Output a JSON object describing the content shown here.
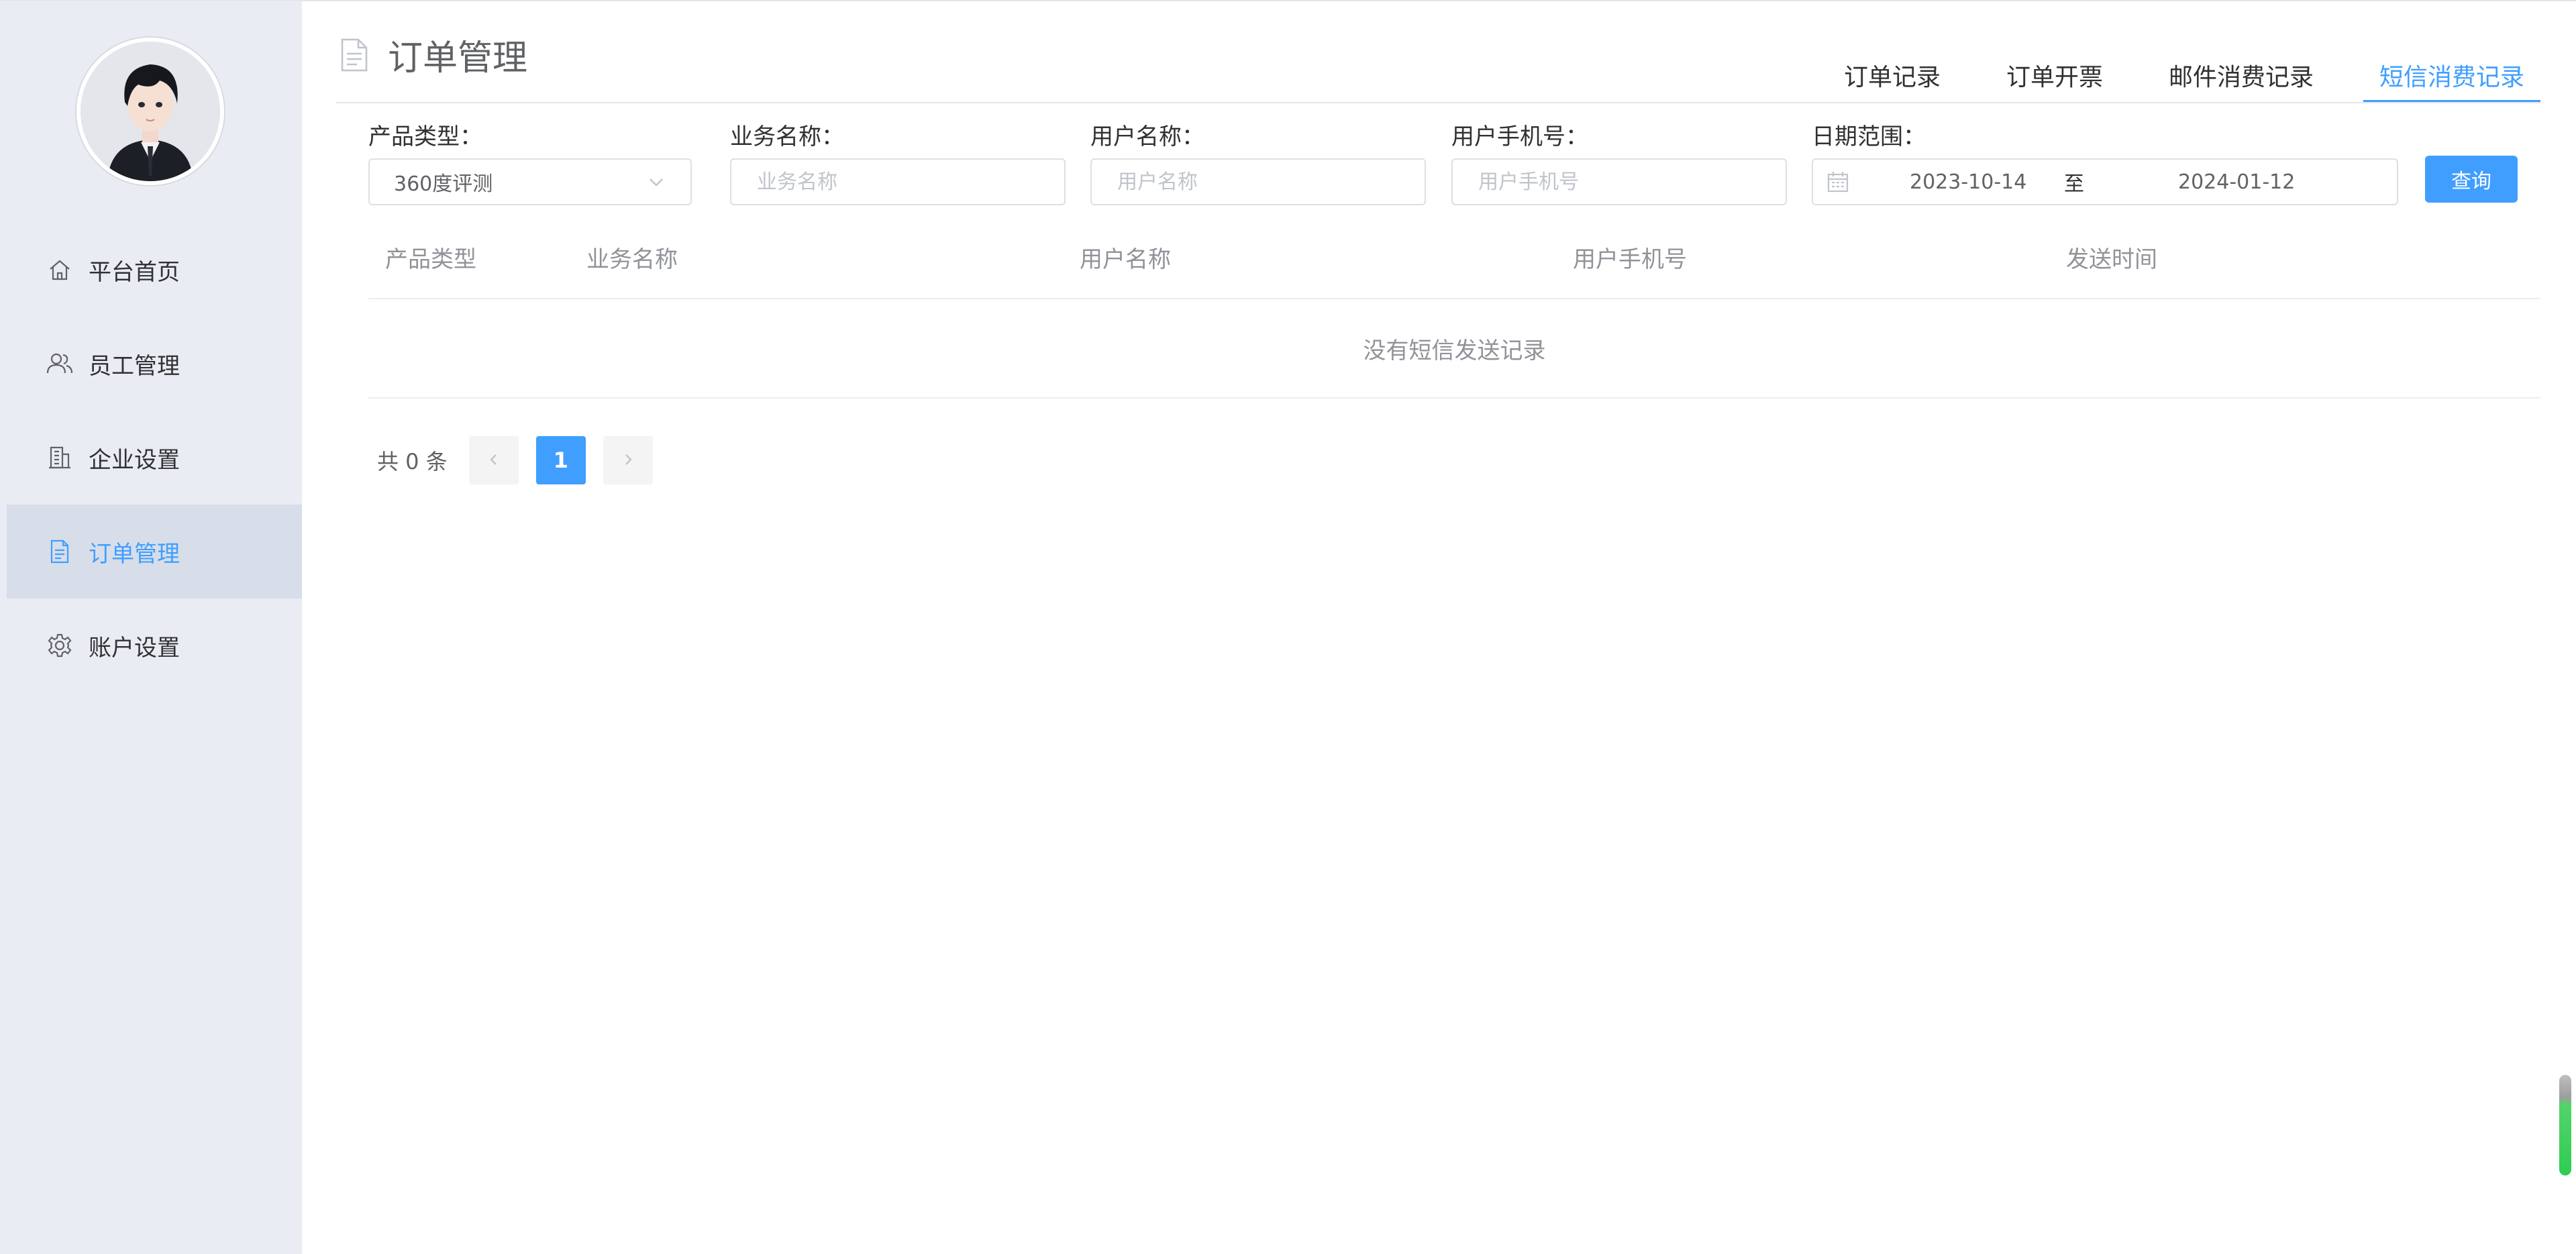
{
  "sidebar": {
    "items": [
      {
        "label": "平台首页",
        "icon": "home-icon",
        "active": false
      },
      {
        "label": "员工管理",
        "icon": "users-icon",
        "active": false
      },
      {
        "label": "企业设置",
        "icon": "building-icon",
        "active": false
      },
      {
        "label": "订单管理",
        "icon": "document-icon",
        "active": true
      },
      {
        "label": "账户设置",
        "icon": "gear-icon",
        "active": false
      }
    ]
  },
  "header": {
    "title": "订单管理",
    "title_icon": "document-icon"
  },
  "tabs": [
    {
      "label": "订单记录",
      "active": false
    },
    {
      "label": "订单开票",
      "active": false
    },
    {
      "label": "邮件消费记录",
      "active": false
    },
    {
      "label": "短信消费记录",
      "active": true
    }
  ],
  "filters": {
    "product_type": {
      "label": "产品类型：",
      "value": "360度评测"
    },
    "business_name": {
      "label": "业务名称：",
      "placeholder": "业务名称",
      "value": ""
    },
    "user_name": {
      "label": "用户名称：",
      "placeholder": "用户名称",
      "value": ""
    },
    "user_phone": {
      "label": "用户手机号：",
      "placeholder": "用户手机号",
      "value": ""
    },
    "date_range": {
      "label": "日期范围：",
      "start": "2023-10-14",
      "separator": "至",
      "end": "2024-01-12"
    },
    "query_button": "查询"
  },
  "table": {
    "columns": [
      "产品类型",
      "业务名称",
      "用户名称",
      "用户手机号",
      "发送时间"
    ],
    "rows": [],
    "empty_text": "没有短信发送记录"
  },
  "pagination": {
    "total_text": "共 0 条",
    "current_page": "1",
    "prev_icon": "chevron-left-icon",
    "next_icon": "chevron-right-icon"
  },
  "colors": {
    "accent": "#409eff",
    "sidebar_bg": "#e9edf3",
    "sidebar_active_bg": "#d7dee9"
  }
}
